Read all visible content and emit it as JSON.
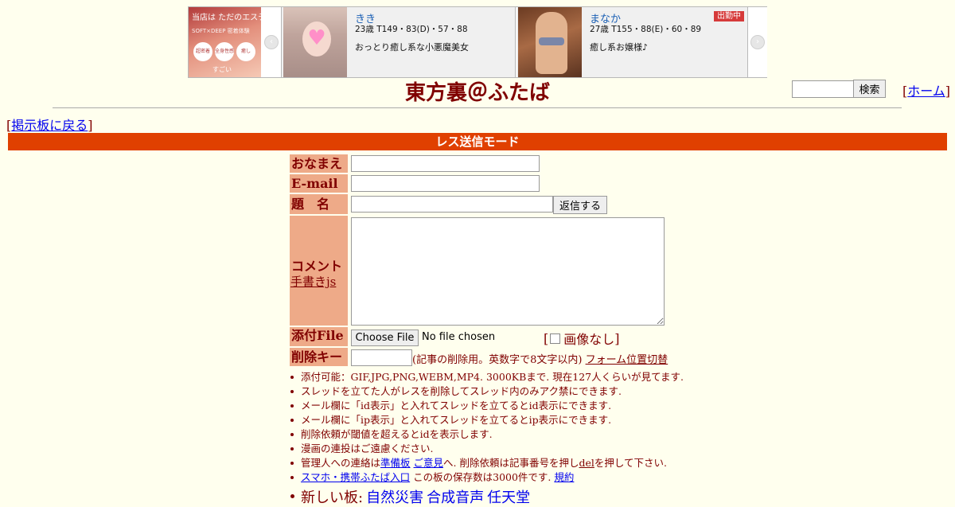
{
  "banner": {
    "promo": {
      "line1": "当店は ただのエステじゃありません",
      "line2": "SOFT×DEEP 密着体験",
      "badge1": "超密着",
      "badge2": "全身性感",
      "badge3": "癒し",
      "line3": "すごい"
    },
    "cards": [
      {
        "name": "きき",
        "stats": "23歳 T149・83(D)・57・88",
        "desc": "おっとり癒し系な小悪魔美女",
        "badge": ""
      },
      {
        "name": "まなか",
        "stats": "27歳 T155・88(E)・60・89",
        "desc": "癒し系お嬢様♪",
        "badge": "出勤中"
      }
    ],
    "prev_arrow": "‹",
    "next_arrow": "›"
  },
  "header": {
    "title": "東方裏＠ふたば",
    "search_button": "検索",
    "home_open": "[",
    "home_label": "ホーム",
    "home_close": "]"
  },
  "nav": {
    "back_open": "[",
    "back_label": "掲示板に戻る",
    "back_close": "]"
  },
  "mode_bar": "レス送信モード",
  "form": {
    "name_label": "おなまえ",
    "email_label": "E-mail",
    "subject_label": "題　名",
    "reply_button": "返信する",
    "comment_label": "コメント",
    "handwrite_link": "手書きjs",
    "file_label": "添付File",
    "choose_file_button": "Choose File",
    "file_status": "No file chosen",
    "noimage_open": "[",
    "noimage_label": "画像なし",
    "noimage_close": "]",
    "delkey_label": "削除キー",
    "delkey_note": "(記事の削除用。英数字で8文字以内)",
    "form_toggle_link": "フォーム位置切替"
  },
  "notes": {
    "n1": "添付可能：GIF,JPG,PNG,WEBM,MP4. 3000KBまで. 現在127人くらいが見てます.",
    "n2": "スレッドを立てた人がレスを削除してスレッド内のみアク禁にできます.",
    "n3": "メール欄に「id表示」と入れてスレッドを立てるとid表示にできます.",
    "n4": "メール欄に「ip表示」と入れてスレッドを立てるとip表示にできます.",
    "n5": "削除依頼が閾値を超えるとidを表示します.",
    "n6": "漫画の連投はご遠慮ください.",
    "n7_pre": "管理人への連絡は",
    "n7_link1": "準備板",
    "n7_link2": "ご意見",
    "n7_mid": "へ. 削除依頼は記事番号を押し",
    "n7_del": "del",
    "n7_post": "を押して下さい.",
    "n8_link": "スマホ・携帯ふたば入口",
    "n8_mid": " この板の保存数は3000件です. ",
    "n8_link2": "規約"
  },
  "new_boards": {
    "prefix": "新しい板:",
    "boards": [
      "自然災害",
      "合成音声",
      "任天堂"
    ]
  },
  "colors": {
    "background": "#ffffee",
    "text": "#800000",
    "mode_bar": "#e04000",
    "label_bg": "#eeaa88",
    "link": "#0000ee"
  }
}
